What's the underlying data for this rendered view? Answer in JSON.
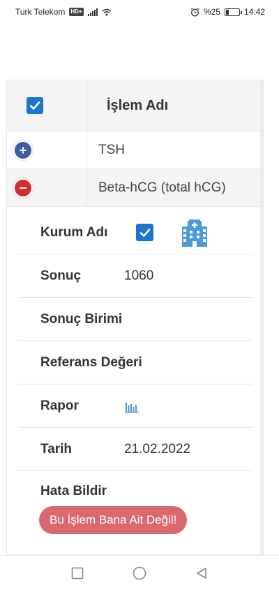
{
  "status_bar": {
    "carrier": "Turk Telekom",
    "network_badge": "HD+",
    "battery_text": "%25",
    "battery_level": 0.25,
    "time": "14:42"
  },
  "table": {
    "header": {
      "title": "İşlem Adı",
      "select_all_checked": true
    },
    "rows": [
      {
        "name": "TSH",
        "icon": "plus-icon",
        "expanded": false
      },
      {
        "name": "Beta-hCG (total hCG)",
        "icon": "minus-icon",
        "expanded": true
      }
    ]
  },
  "detail": {
    "kurum_label": "Kurum Adı",
    "kurum_checked": true,
    "kurum_icon": "hospital-building-icon",
    "sonuc_label": "Sonuç",
    "sonuc_value": "1060",
    "sonuc_birimi_label": "Sonuç Birimi",
    "sonuc_birimi_value": "",
    "referans_label": "Referans Değeri",
    "referans_value": "",
    "rapor_label": "Rapor",
    "rapor_icon": "bar-chart-icon",
    "tarih_label": "Tarih",
    "tarih_value": "21.02.2022",
    "hata_label": "Hata Bildir",
    "hata_button": "Bu İşlem Bana Ait Değil!"
  },
  "colors": {
    "checkbox": "#1976d2",
    "plus_button": "#3d5d9e",
    "minus_button": "#d32f2f",
    "report_button": "#d9686f",
    "hospital_icon": "#4a9bd8"
  },
  "nav": {
    "icons": [
      "recent-apps-icon",
      "home-icon",
      "back-icon"
    ]
  }
}
